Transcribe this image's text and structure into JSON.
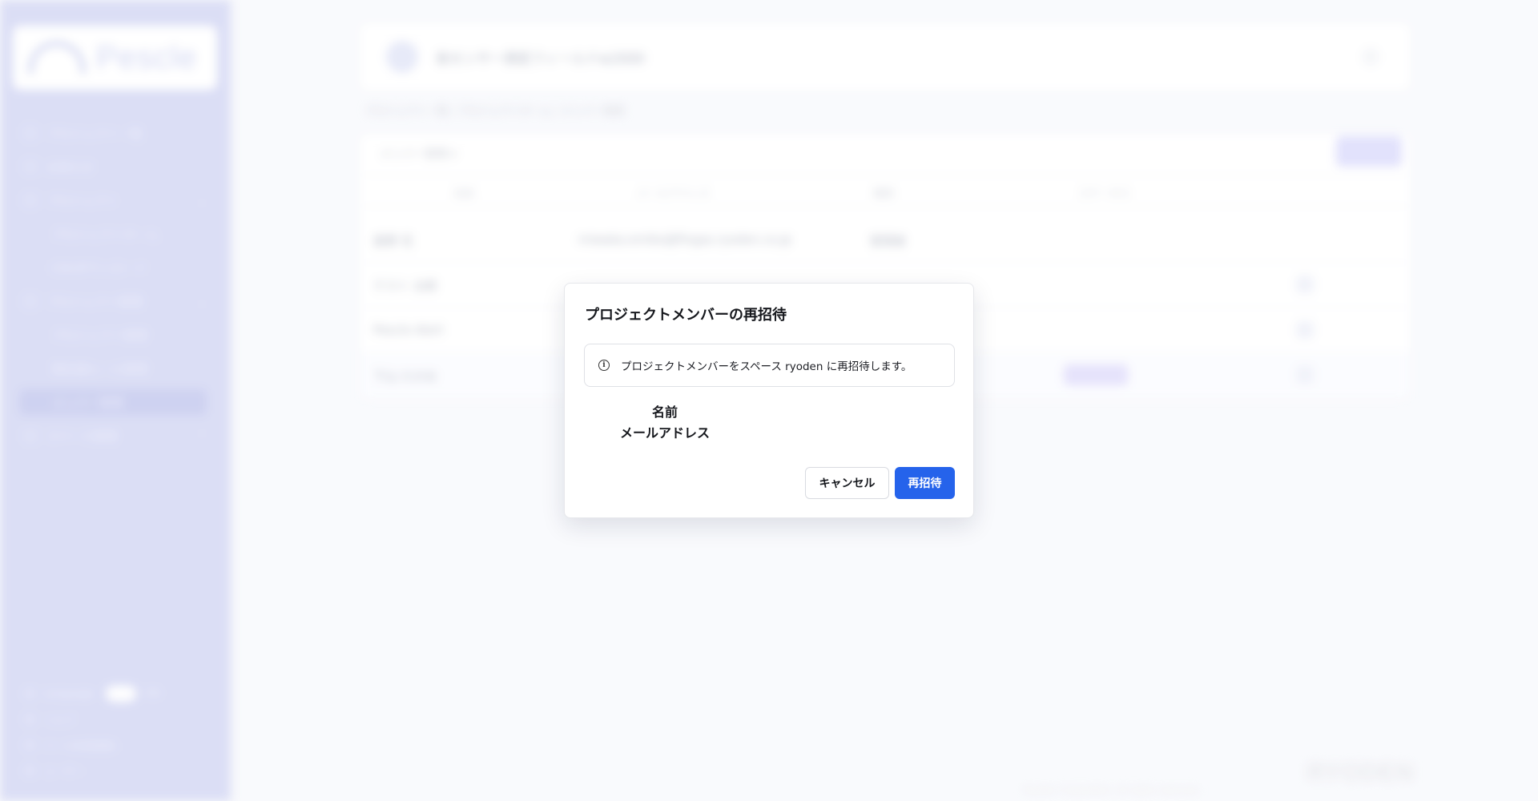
{
  "sidebar": {
    "logo_text": "Pescle",
    "items": [
      {
        "label": "プロジェクト一覧"
      },
      {
        "label": "お知らせ"
      },
      {
        "label": "プロジェクト"
      },
      {
        "label": "プロジェクトホーム"
      },
      {
        "label": "CSVダウンロード"
      },
      {
        "label": "プロジェクト管理"
      },
      {
        "label": "プロジェクト管理"
      },
      {
        "label": "現在値ルール管理"
      },
      {
        "label": "メンバー管理"
      },
      {
        "label": "スペース管理"
      }
    ],
    "language_label": "Language",
    "language_alt": "EN",
    "bottom_items": [
      {
        "label": "ヘルプ"
      },
      {
        "label": "ツール利用規約"
      },
      {
        "label": "ユーザー"
      }
    ]
  },
  "header": {
    "project_title": "各センサー測定フィールドw2000"
  },
  "breadcrumb": "プロジェクト一覧 / プロジェクトホーム / メンバー管理",
  "panel": {
    "title": "メンバー管理 ▾",
    "columns": [
      "名前",
      "メールアドレス",
      "権限",
      "ステータス"
    ],
    "rows": [
      {
        "name": "星野 花",
        "email": "miwaka.emiko@fingas.ryoden.co.jp",
        "role": "管理者"
      },
      {
        "name": "テスト 太郎",
        "email": "",
        "role": ""
      },
      {
        "name": "Pescle Alert",
        "email": "",
        "role": ""
      },
      {
        "name": "下山 たかお",
        "email": "",
        "role": ""
      }
    ]
  },
  "footer": {
    "brand": "RYODEN",
    "copyright": "Ryoden Corporation. All rights reserved."
  },
  "modal": {
    "title": "プロジェクトメンバーの再招待",
    "info_icon": "info-icon",
    "info_text": "プロジェクトメンバーをスペース ryoden に再招待します。",
    "name_label": "名前",
    "email_label": "メールアドレス",
    "cancel_label": "キャンセル",
    "reinvite_label": "再招待"
  },
  "colors": {
    "primary": "#2563eb",
    "sidebar_bg": "#cfd3f2"
  }
}
